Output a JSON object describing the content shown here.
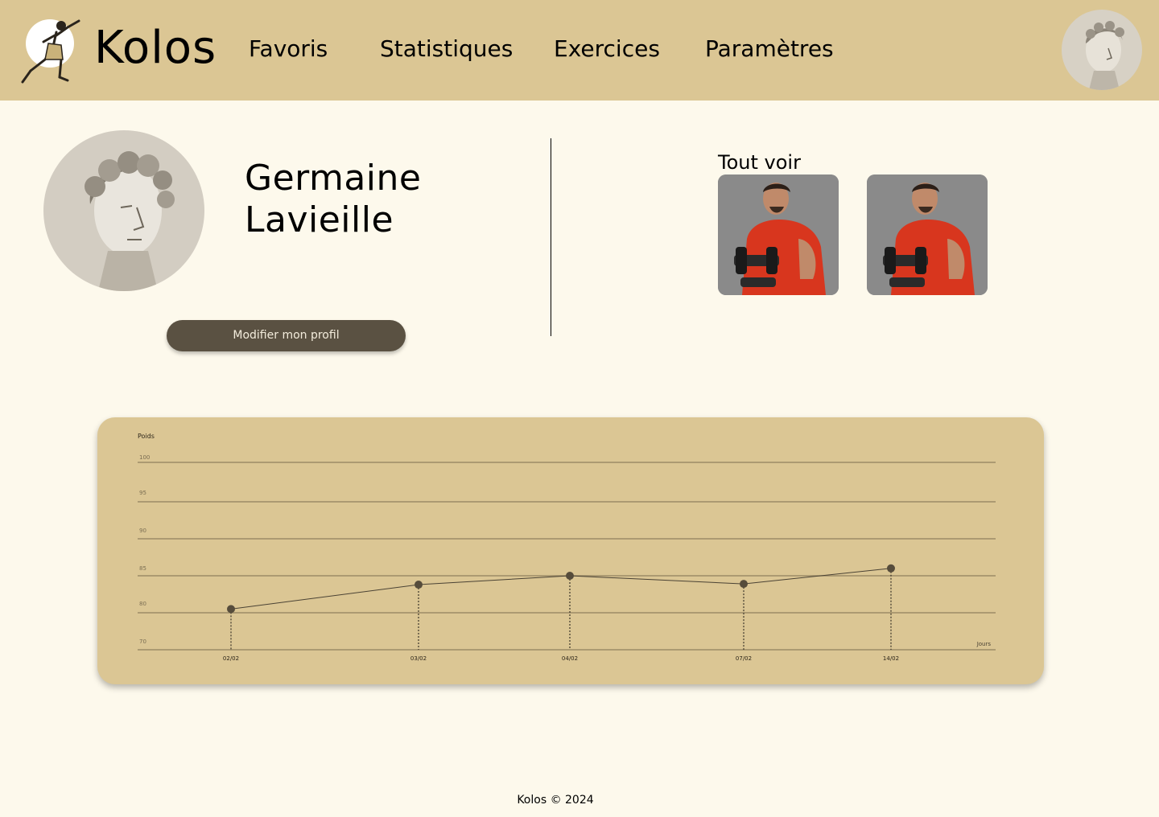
{
  "header": {
    "logo_text": "Kolos",
    "logo_icon": "runner-statue-icon",
    "nav": [
      "Favoris",
      "Statistiques",
      "Exercices",
      "Paramètres"
    ],
    "avatar_icon": "statue-head-avatar"
  },
  "profile": {
    "first_name": "Germaine",
    "last_name": "Lavieille",
    "edit_label": "Modifier mon profil"
  },
  "favorites": {
    "see_all_label": "Tout voir",
    "items": [
      "exercise-thumbnail-dumbbell",
      "exercise-thumbnail-dumbbell"
    ]
  },
  "colors": {
    "header_bg": "#dbc694",
    "page_bg": "#fdf9ec",
    "button_bg": "#5a5142",
    "chart_line": "#5a5142"
  },
  "chart_data": {
    "type": "line",
    "title": "",
    "ylabel": "Poids",
    "xlabel": "Jours",
    "y_ticks": [
      100,
      95,
      90,
      85,
      80,
      70
    ],
    "categories": [
      "02/02",
      "03/02",
      "04/02",
      "07/02",
      "14/02"
    ],
    "values": [
      80.5,
      83.8,
      85,
      83.9,
      86
    ],
    "grid": true,
    "legend": "none"
  },
  "footer": {
    "text": "Kolos © 2024"
  }
}
